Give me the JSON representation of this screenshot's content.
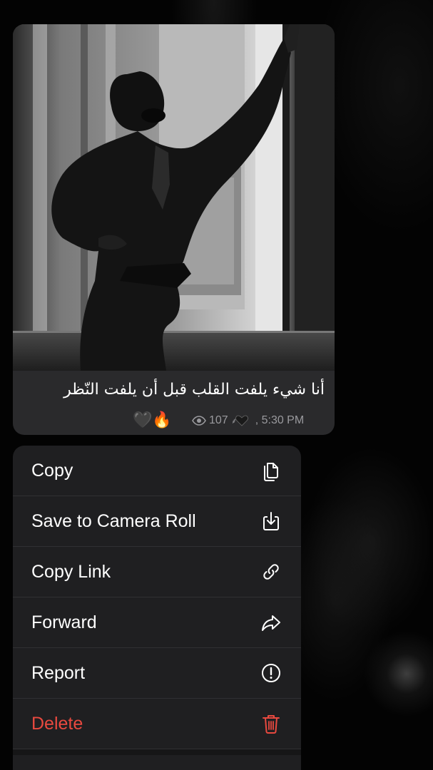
{
  "message": {
    "caption": "أنا شيء يلفت القلب قبل أن يلفت النّظر",
    "reactions": [
      "🖤",
      "🔥"
    ],
    "views": "107",
    "signature_icon": "black-heart",
    "time": ", 5:30 PM",
    "image_description": "black and white photo"
  },
  "context_menu": {
    "items": [
      {
        "label": "Copy",
        "icon": "copy-icon"
      },
      {
        "label": "Save to Camera Roll",
        "icon": "save-icon"
      },
      {
        "label": "Copy Link",
        "icon": "link-icon"
      },
      {
        "label": "Forward",
        "icon": "forward-icon"
      },
      {
        "label": "Report",
        "icon": "report-icon"
      },
      {
        "label": "Delete",
        "icon": "trash-icon"
      }
    ]
  },
  "colors": {
    "background": "#000000",
    "bubble": "#2a2a2c",
    "menu": "#1f1f21",
    "danger": "#e8493f",
    "meta_text": "#9a9a9e"
  }
}
